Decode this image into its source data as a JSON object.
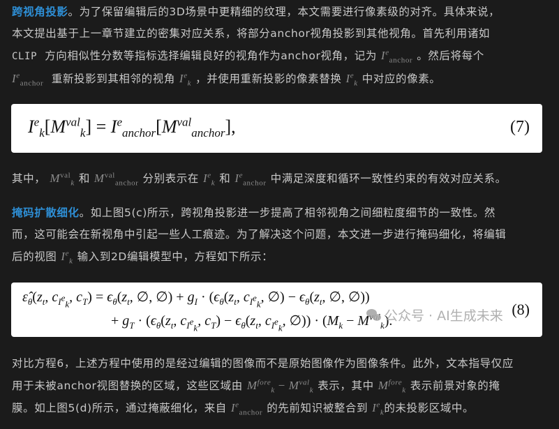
{
  "section1": {
    "heading": "跨视角投影",
    "line1_rest": "。为了保留编辑后的3D场景中更精细的纹理，本文需要进行像素级的对齐。具体来说，",
    "line2": "本文提出基于上一章节建立的密集对应关系，将部分anchor视角投影到其他视角。首先利用诸如",
    "line3_clip": "CLIP",
    "line3_rest": "方向相似性分数等指标选择编辑良好的视角作为anchor视角，记为",
    "line3_end": "。然后将每个",
    "line4_a": "重新投影到其相邻的视角",
    "line4_b": "，并使用重新投影的像素替换",
    "line4_c": "中对应的像素。"
  },
  "equation7": {
    "number": "(7)"
  },
  "para2": {
    "prefix": "其中，",
    "and1": "和",
    "mid": "分别表示在",
    "and2": "和",
    "suffix": "中满足深度和循环一致性约束的有效对应关系。"
  },
  "section2": {
    "heading": "掩码扩散细化",
    "line1_rest": "。如上图5(c)所示，跨视角投影进一步提高了相邻视角之间细粒度细节的一致性。然",
    "line2": "而，这可能会在新视角中引起一些人工痕迹。为了解决这个问题，本文进一步进行掩码细化，将编辑",
    "line3_a": "后的视图",
    "line3_b": "输入到2D编辑模型中，方程如下所示："
  },
  "equation8": {
    "number": "(8)"
  },
  "watermark": {
    "text": "公众号 · AI生成未来"
  },
  "para4": {
    "line1": "对比方程6，上述方程中使用的是经过编辑的图像而不是原始图像作为图像条件。此外，文本指导仅应",
    "line2_a": "用于未被anchor视图替换的区域，这些区域由",
    "line2_b": "表示，其中",
    "line2_c": "表示前景对象的掩",
    "line3_a": "膜。如上图5(d)所示，通过掩蔽细化，来自",
    "line3_b": "的先前知识被整合到",
    "line3_c": "的未投影区域中。"
  },
  "colors": {
    "background": "#1b1b1b",
    "text": "#c9c9c9",
    "heading_accent": "#2e8fd6",
    "math_inline": "#8c8c8c",
    "equation_box": "#ffffff"
  }
}
